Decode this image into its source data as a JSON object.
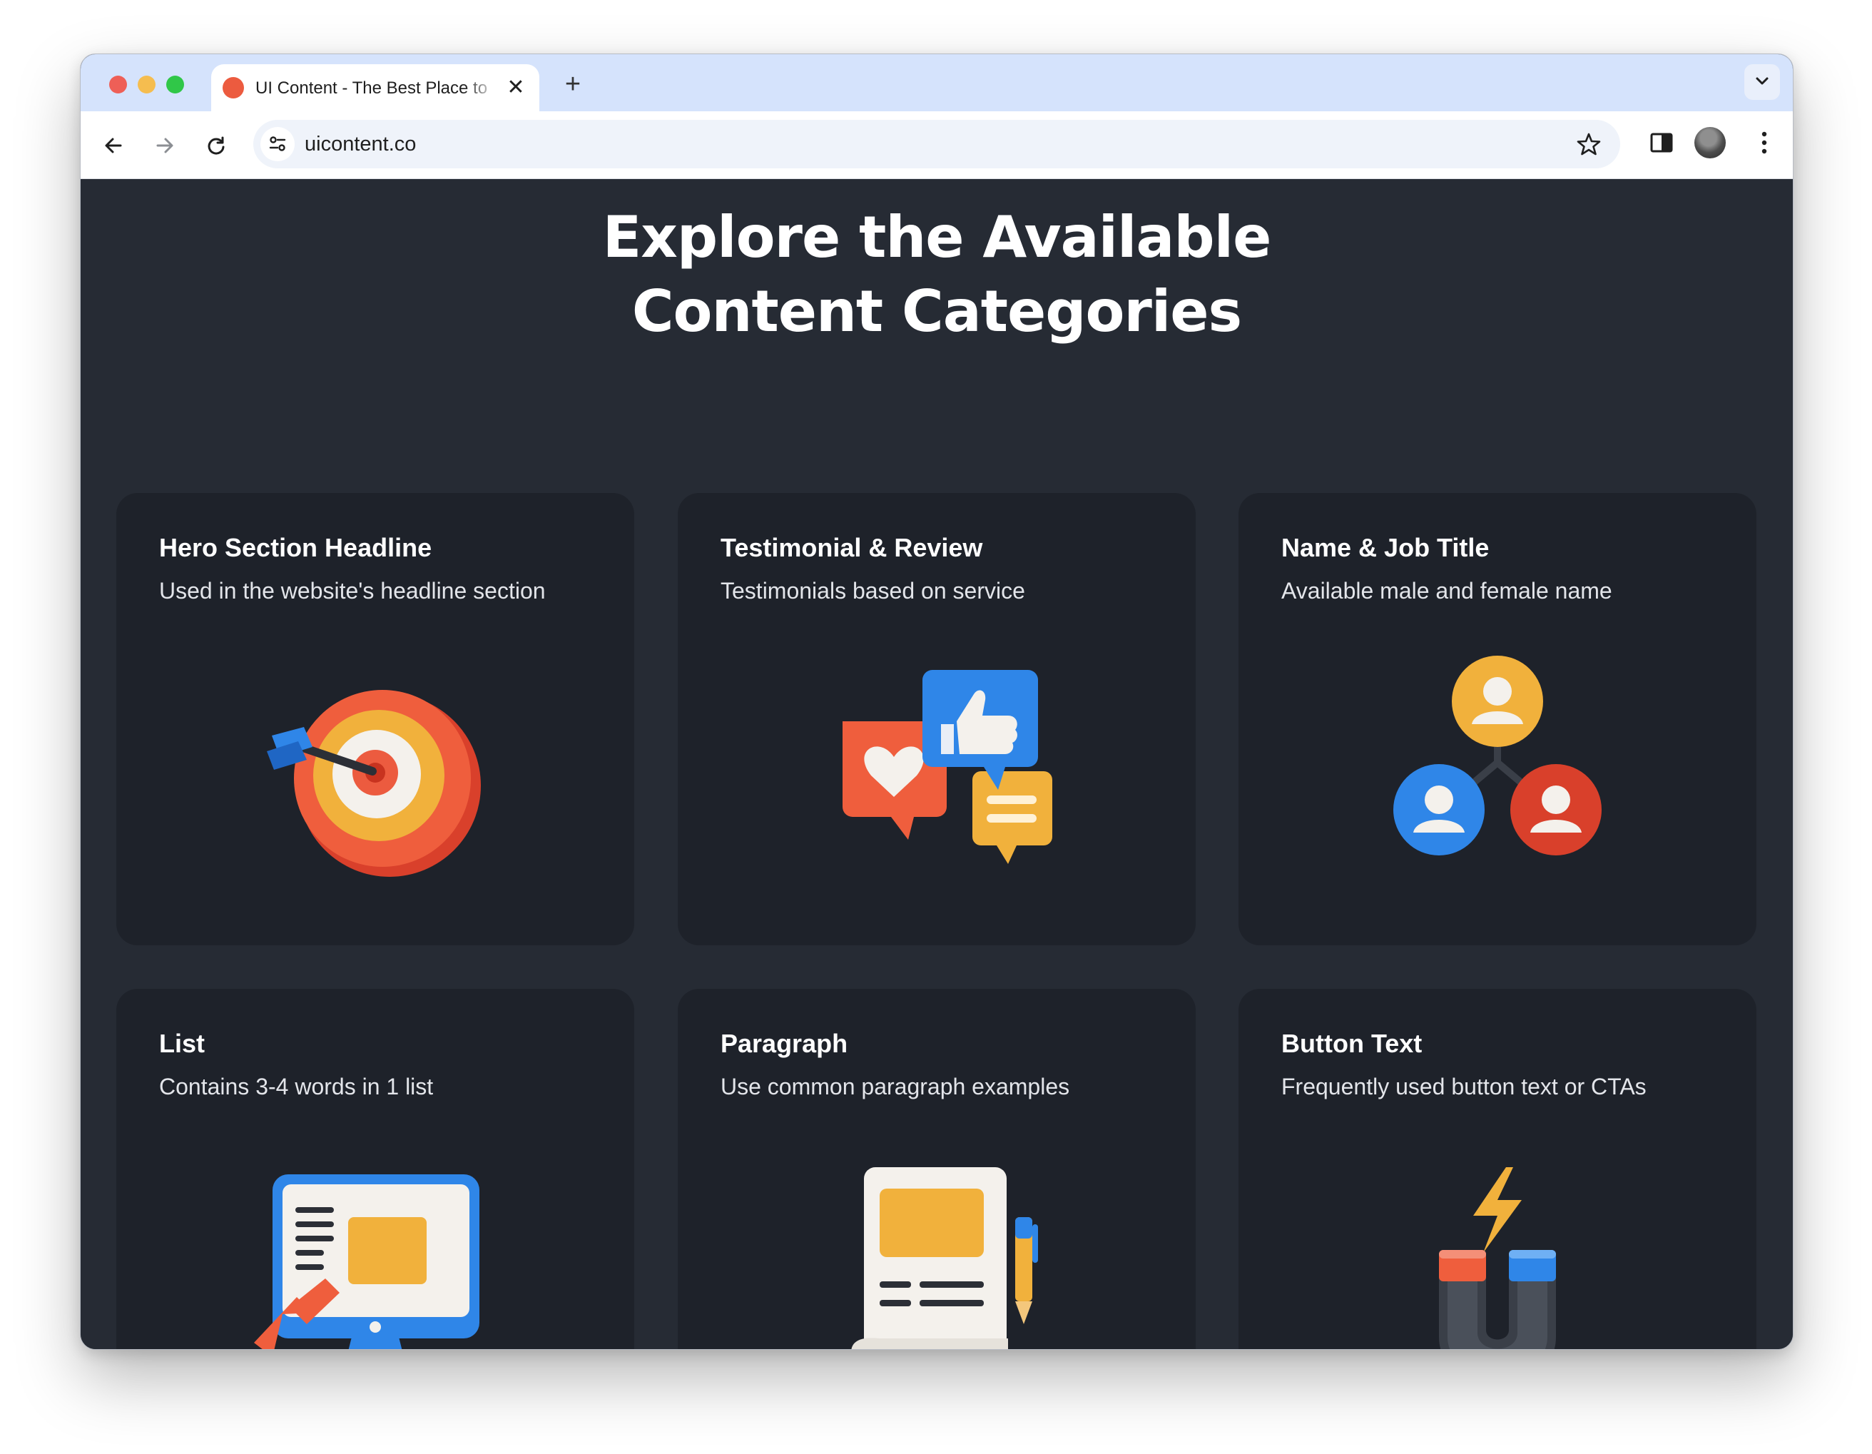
{
  "browser": {
    "tab": {
      "title": "UI Content - The Best Place to",
      "close_glyph": "✕",
      "favicon": "ui-content-favicon"
    },
    "new_tab_glyph": "+",
    "address_bar": {
      "url": "uicontent.co"
    },
    "icons": [
      "back-arrow-icon",
      "forward-arrow-icon",
      "reload-icon",
      "site-info-icon",
      "star-icon",
      "side-panel-icon",
      "profile-avatar",
      "more-vert-icon",
      "chevron-down-icon"
    ]
  },
  "page": {
    "headline_line1": "Explore the Available",
    "headline_line2": "Content Categories",
    "cards": [
      {
        "title": "Hero Section Headline",
        "description": "Used in the website's headline section",
        "illustration": "target-dart-icon"
      },
      {
        "title": "Testimonial & Review",
        "description": "Testimonials based on service",
        "illustration": "chat-bubbles-icon"
      },
      {
        "title": "Name & Job Title",
        "description": "Available male and female name",
        "illustration": "user-network-icon"
      },
      {
        "title": "List",
        "description": "Contains 3-4 words in 1 list",
        "illustration": "monitor-list-icon"
      },
      {
        "title": "Paragraph",
        "description": "Use common paragraph examples",
        "illustration": "document-pencil-icon"
      },
      {
        "title": "Button Text",
        "description": "Frequently used button text or CTAs",
        "illustration": "magnet-bolt-icon"
      }
    ]
  },
  "colors": {
    "page_bg": "#262b34",
    "card_bg": "#1e222a",
    "tabstrip": "#d5e3fc",
    "accent_red": "#ec5b3f",
    "accent_blue": "#2f86e8",
    "accent_yellow": "#f1b13c"
  }
}
